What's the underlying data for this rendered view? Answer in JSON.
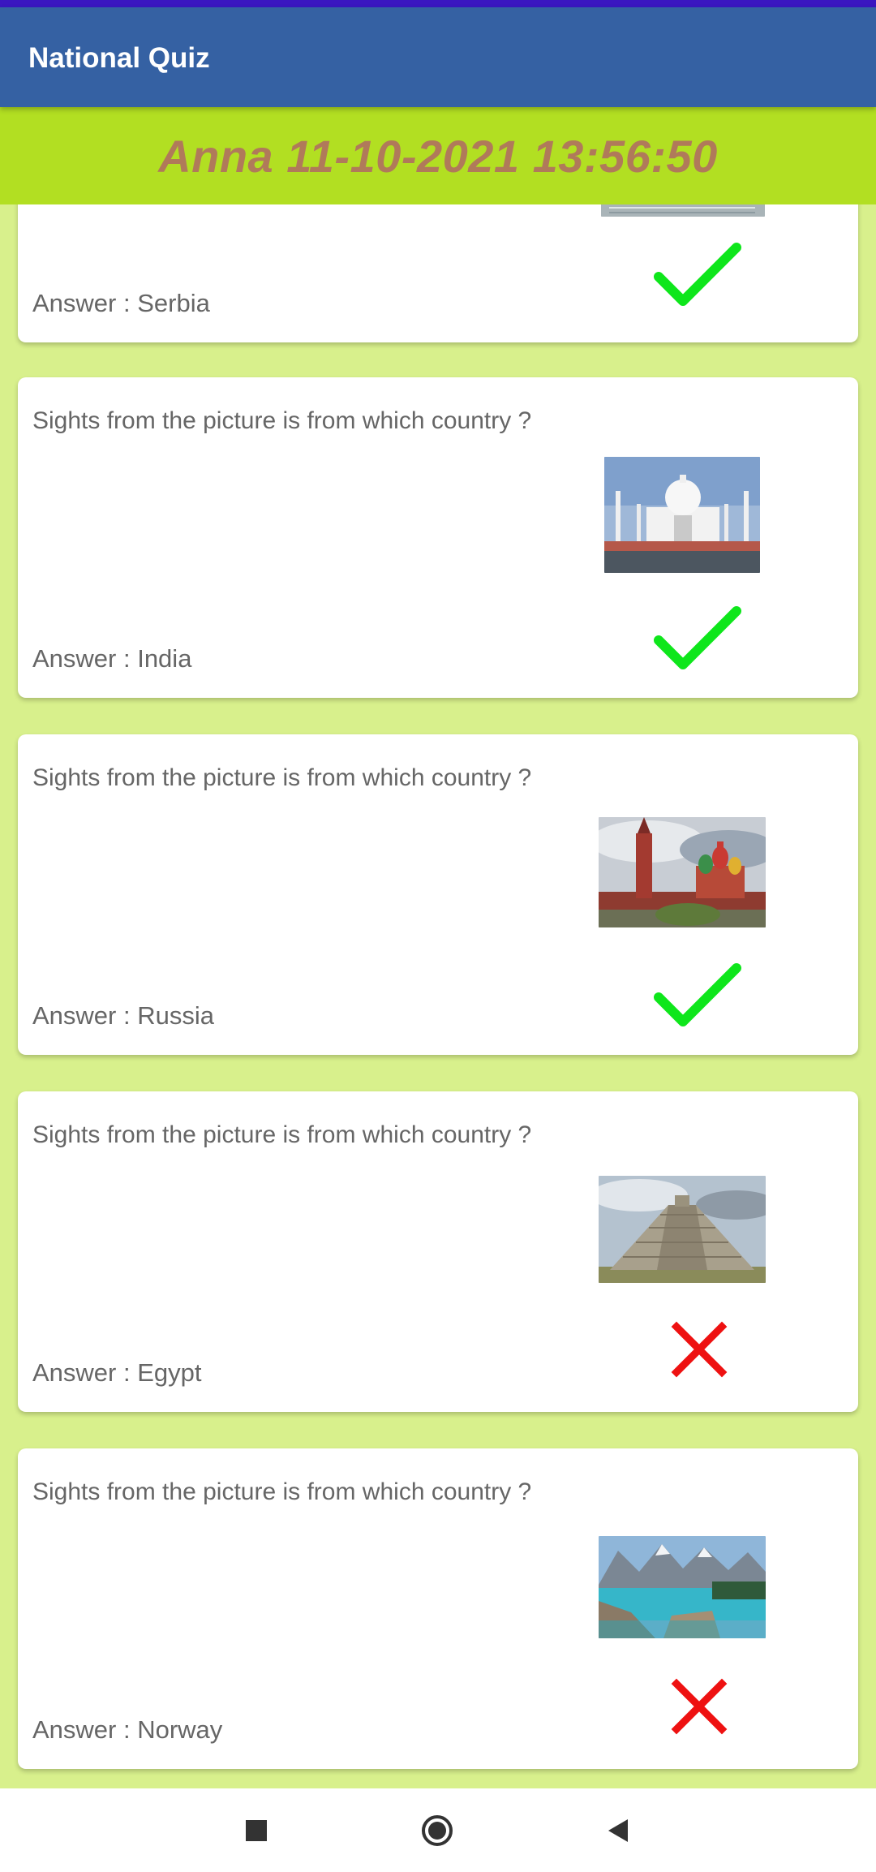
{
  "app": {
    "title": "National Quiz"
  },
  "banner": {
    "text": "Anna 11-10-2021 13:56:50"
  },
  "cards": [
    {
      "question": "",
      "answer": "Answer : Serbia",
      "result_icon": "check-icon",
      "thumb": "building-photo"
    },
    {
      "question": "Sights from the picture is from which country ?",
      "answer": "Answer : India",
      "result_icon": "check-icon",
      "thumb": "taj-mahal-photo"
    },
    {
      "question": "Sights from the picture is from which country ?",
      "answer": "Answer : Russia",
      "result_icon": "check-icon",
      "thumb": "kremlin-photo"
    },
    {
      "question": "Sights from the picture is from which country ?",
      "answer": "Answer : Egypt",
      "result_icon": "cross-icon",
      "thumb": "pyramid-photo"
    },
    {
      "question": "Sights from the picture is from which country ?",
      "answer": "Answer : Norway",
      "result_icon": "cross-icon",
      "thumb": "lake-photo"
    }
  ],
  "colors": {
    "app_bar": "#3561a3",
    "banner": "#b2df22",
    "banner_text": "#b07a5a",
    "background": "#d8f08c",
    "correct": "#0ee61b",
    "wrong": "#ee1111"
  },
  "nav": {
    "icons": [
      "recents-square-icon",
      "home-circle-icon",
      "back-triangle-icon"
    ]
  }
}
